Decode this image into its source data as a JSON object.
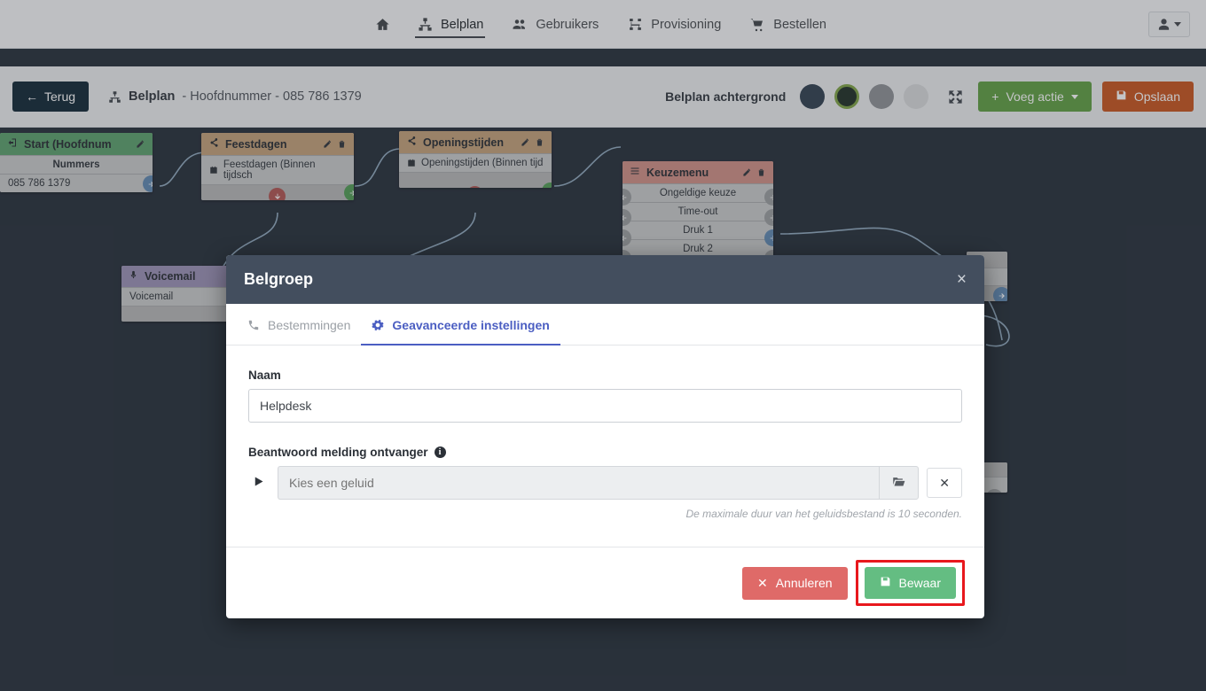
{
  "topnav": {
    "items": [
      {
        "label": "",
        "icon": "home-icon",
        "active": false
      },
      {
        "label": "Belplan",
        "icon": "sitemap-icon",
        "active": true
      },
      {
        "label": "Gebruikers",
        "icon": "users-icon",
        "active": false
      },
      {
        "label": "Provisioning",
        "icon": "provisioning-icon",
        "active": false
      },
      {
        "label": "Bestellen",
        "icon": "cart-icon",
        "active": false
      }
    ],
    "user_menu": "user-icon"
  },
  "toolbar": {
    "back_label": "Terug",
    "breadcrumb_strong": "Belplan",
    "breadcrumb_rest": "- Hoofdnummer - 085 786 1379",
    "background_label": "Belplan achtergrond",
    "swatches": [
      {
        "color": "#2d3d4c",
        "selected": false
      },
      {
        "color": "#1c2b22",
        "selected": true
      },
      {
        "color": "#8d9094",
        "selected": false
      },
      {
        "color": "#d9dadc",
        "selected": false
      }
    ],
    "expand_icon": "expand-arrows-icon",
    "add_action_label": "Voeg actie",
    "save_label": "Opslaan"
  },
  "canvas": {
    "background_color": "#222b36",
    "nodes": [
      {
        "id": "start",
        "title": "Start (Hoofdnum",
        "icon": "sign-in-icon",
        "header_color": "#5aa06a",
        "rows": [
          "Nummers",
          "085 786 1379"
        ]
      },
      {
        "id": "feestdagen",
        "title": "Feestdagen",
        "icon": "share-icon",
        "header_color": "#c3a077",
        "rows": [
          "Feestdagen (Binnen tijdsch"
        ]
      },
      {
        "id": "openingstijden",
        "title": "Openingstijden",
        "icon": "share-icon",
        "header_color": "#c3a077",
        "rows": [
          "Openingstijden (Binnen tijd"
        ]
      },
      {
        "id": "keuzemenu",
        "title": "Keuzemenu",
        "icon": "list-icon",
        "header_color": "#d08f85",
        "rows": [
          "Ongeldige keuze",
          "Time-out",
          "Druk 1",
          "Druk 2"
        ]
      },
      {
        "id": "voicemail",
        "title": "Voicemail",
        "icon": "microphone-icon",
        "header_color": "#9a90b5",
        "rows": [
          "Voicemail"
        ]
      }
    ]
  },
  "modal": {
    "title": "Belgroep",
    "close_label": "×",
    "tabs": [
      {
        "label": "Bestemmingen",
        "icon": "phone-icon",
        "active": false
      },
      {
        "label": "Geavanceerde instellingen",
        "icon": "gear-icon",
        "active": true
      }
    ],
    "accent_color": "#4b5ec2",
    "name_label": "Naam",
    "name_value": "Helpdesk",
    "name_placeholder": "Naam",
    "sound_label": "Beantwoord melding ontvanger",
    "sound_info_icon": "info-icon",
    "play_icon": "play-icon",
    "sound_placeholder": "Kies een geluid",
    "sound_value": "",
    "browse_icon": "folder-open-icon",
    "clear_icon": "times-icon",
    "hint": "De maximale duur van het geluidsbestand is 10 seconden.",
    "cancel_label": "Annuleren",
    "save_label": "Bewaar",
    "highlight_color": "#e8181d"
  }
}
